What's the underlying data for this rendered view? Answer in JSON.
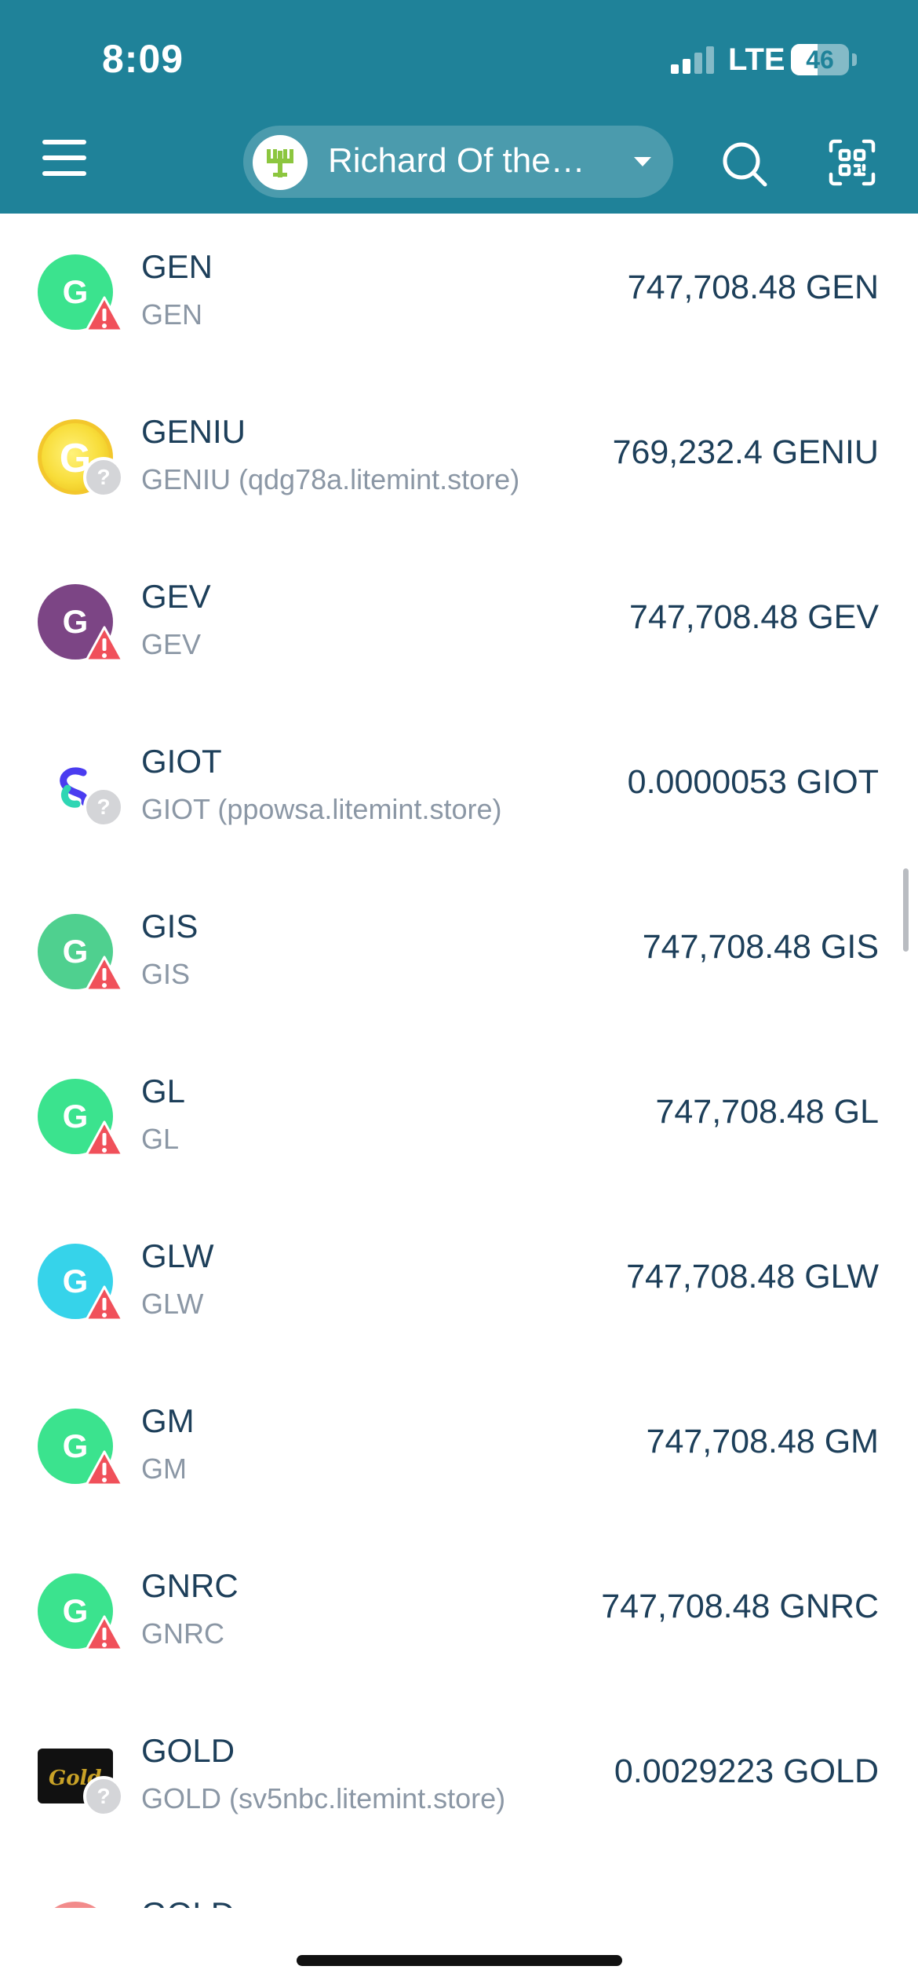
{
  "status_bar": {
    "time": "8:09",
    "network": "LTE",
    "battery": "46",
    "battery_level_percent": 46
  },
  "header": {
    "menu_icon": "hamburger-menu-icon",
    "account_name": "Richard Of the…",
    "search_icon": "search-icon",
    "scan_icon": "qr-scan-icon",
    "background_color": "#1f8299"
  },
  "tokens": [
    {
      "name": "GEN",
      "subtitle": "GEN",
      "balance": "747,708.48 GEN",
      "icon_letter": "G",
      "icon_color": "#3be38e",
      "icon_type": "letter",
      "badge": "warning-icon"
    },
    {
      "name": "GENIU",
      "subtitle": "GENIU (qdg78a.litemint.store)",
      "balance": "769,232.4 GENIU",
      "icon_letter": "G",
      "icon_color": "#f8dd3a",
      "icon_type": "coin",
      "badge": "unknown-icon"
    },
    {
      "name": "GEV",
      "subtitle": "GEV",
      "balance": "747,708.48 GEV",
      "icon_letter": "G",
      "icon_color": "#7c4585",
      "icon_type": "letter",
      "badge": "warning-icon"
    },
    {
      "name": "GIOT",
      "subtitle": "GIOT (ppowsa.litemint.store)",
      "balance": "0.0000053 GIOT",
      "icon_letter": "",
      "icon_color": "#ffffff",
      "icon_type": "swirl",
      "badge": "unknown-icon"
    },
    {
      "name": "GIS",
      "subtitle": "GIS",
      "balance": "747,708.48 GIS",
      "icon_letter": "G",
      "icon_color": "#4fd08f",
      "icon_type": "letter",
      "badge": "warning-icon"
    },
    {
      "name": "GL",
      "subtitle": "GL",
      "balance": "747,708.48 GL",
      "icon_letter": "G",
      "icon_color": "#3be38e",
      "icon_type": "letter",
      "badge": "warning-icon"
    },
    {
      "name": "GLW",
      "subtitle": "GLW",
      "balance": "747,708.48 GLW",
      "icon_letter": "G",
      "icon_color": "#36d3ea",
      "icon_type": "letter",
      "badge": "warning-icon"
    },
    {
      "name": "GM",
      "subtitle": "GM",
      "balance": "747,708.48 GM",
      "icon_letter": "G",
      "icon_color": "#3be38e",
      "icon_type": "letter",
      "badge": "warning-icon"
    },
    {
      "name": "GNRC",
      "subtitle": "GNRC",
      "balance": "747,708.48 GNRC",
      "icon_letter": "G",
      "icon_color": "#3be38e",
      "icon_type": "letter",
      "badge": "warning-icon"
    },
    {
      "name": "GOLD",
      "subtitle": "GOLD (sv5nbc.litemint.store)",
      "balance": "0.0029223 GOLD",
      "icon_letter": "Gold",
      "icon_color": "#111111",
      "icon_type": "logo",
      "badge": "unknown-icon"
    }
  ],
  "partial_row": {
    "name": "GOLD"
  }
}
